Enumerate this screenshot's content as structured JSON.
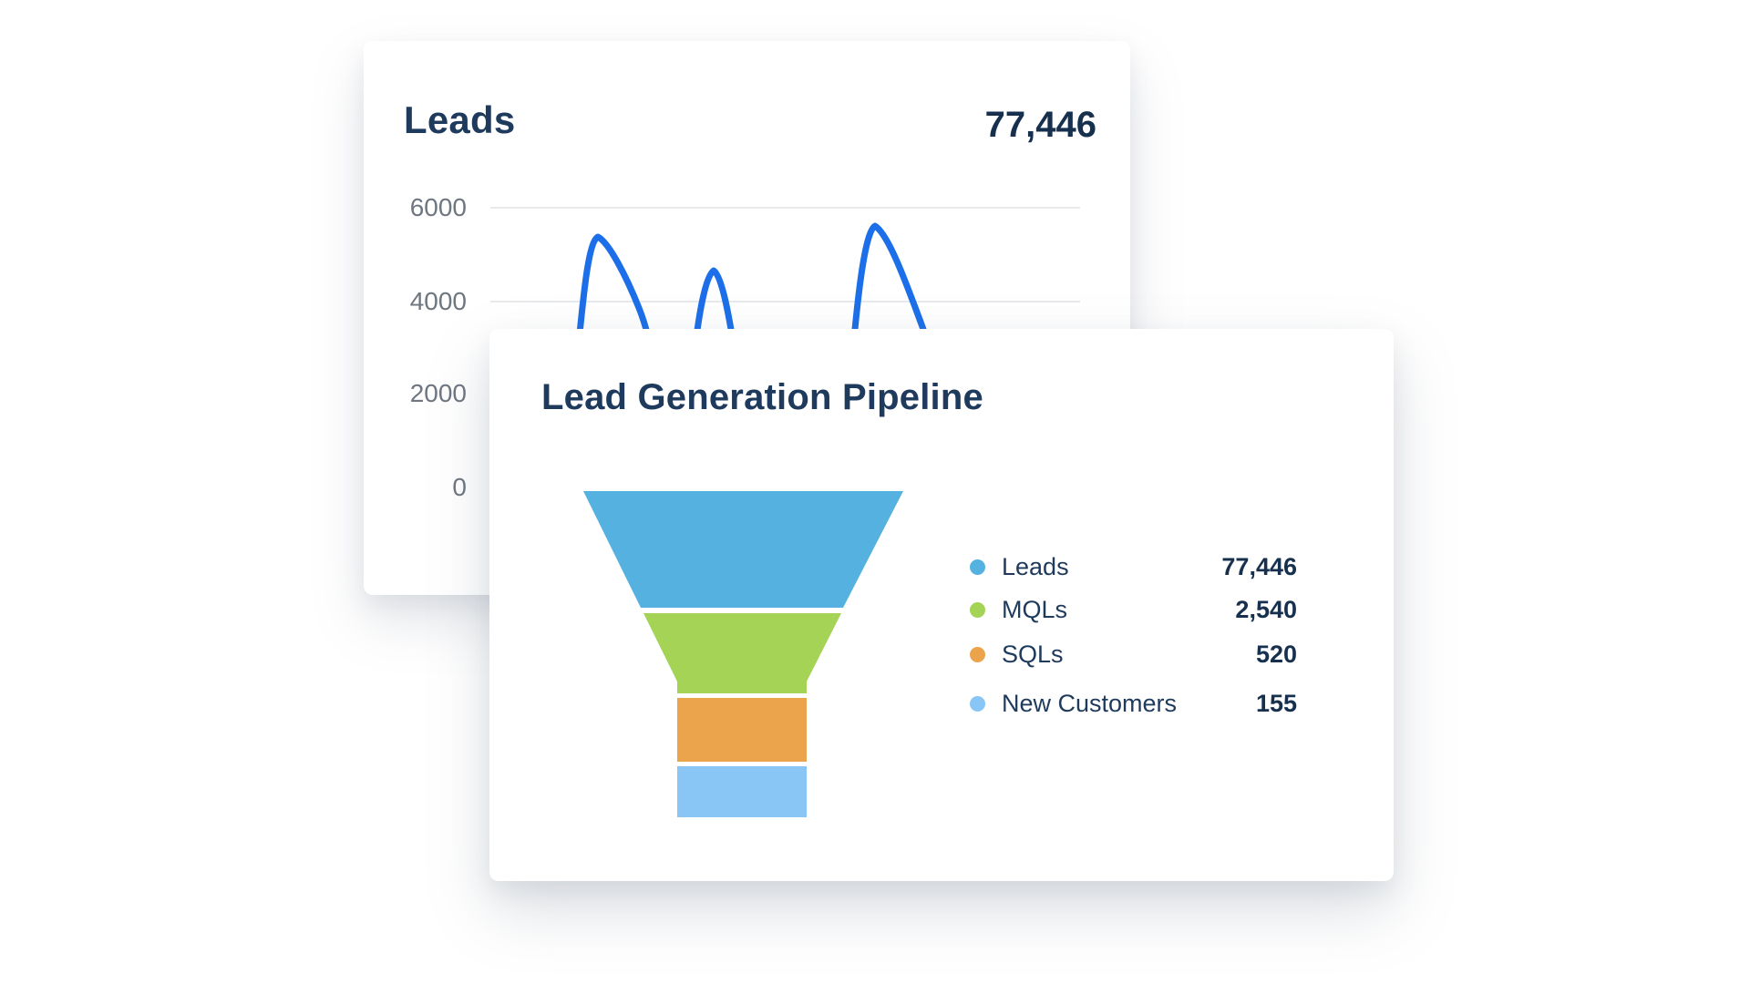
{
  "leads_card": {
    "title": "Leads",
    "total": "77,446",
    "y_axis_labels": [
      "6000",
      "4000",
      "2000",
      "0"
    ],
    "line_color": "#1c6fe8",
    "grid_color": "#e8eaec",
    "axis_label_color": "#6e7680"
  },
  "pipeline_card": {
    "title": "Lead Generation Pipeline",
    "legend": [
      {
        "label": "Leads",
        "value": "77,446",
        "color": "#55b1e0"
      },
      {
        "label": "MQLs",
        "value": "2,540",
        "color": "#a4d356"
      },
      {
        "label": "SQLs",
        "value": "520",
        "color": "#eba44c"
      },
      {
        "label": "New Customers",
        "value": "155",
        "color": "#89c6f6"
      }
    ]
  },
  "chart_data": [
    {
      "type": "line",
      "title": "Leads",
      "summary_value": 77446,
      "xlabel": "",
      "ylabel": "",
      "ylim": [
        0,
        6000
      ],
      "yticks": [
        0,
        2000,
        4000,
        6000
      ],
      "grid": true,
      "legend_position": "none",
      "series": [
        {
          "name": "Leads",
          "visible_peaks_approx": [
            5400,
            4650,
            5600
          ],
          "note": "Three sharp peaks visible; lower portion of curve and x-axis occluded by overlapping foreground card"
        }
      ]
    },
    {
      "type": "funnel",
      "title": "Lead Generation Pipeline",
      "stages": [
        {
          "label": "Leads",
          "value": 77446,
          "color": "#55b1e0"
        },
        {
          "label": "MQLs",
          "value": 2540,
          "color": "#a4d356"
        },
        {
          "label": "SQLs",
          "value": 520,
          "color": "#eba44c"
        },
        {
          "label": "New Customers",
          "value": 155,
          "color": "#89c6f6"
        }
      ],
      "legend_position": "right"
    }
  ]
}
